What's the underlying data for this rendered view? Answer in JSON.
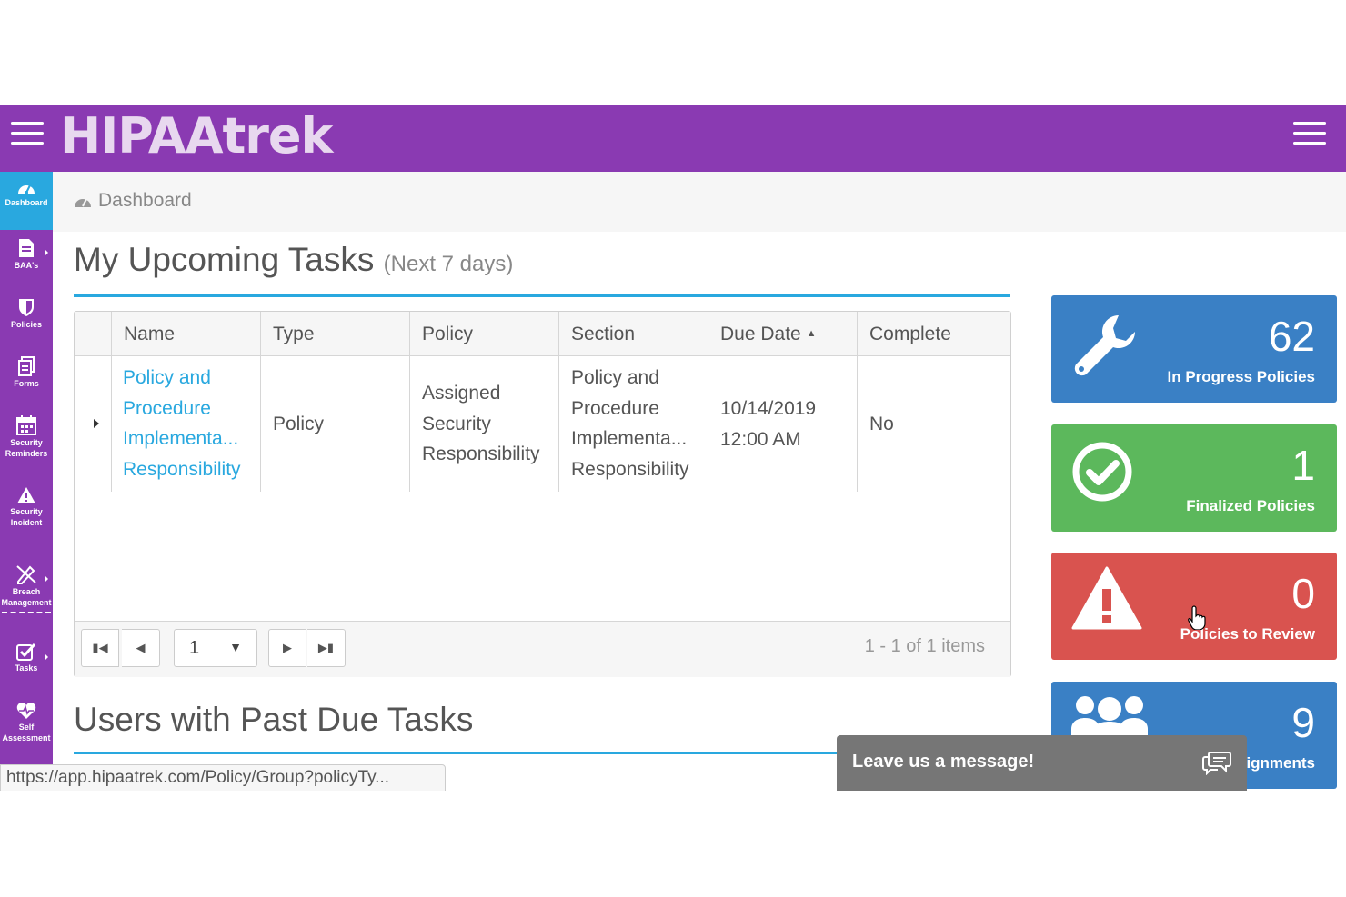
{
  "app": {
    "logo": "HIPAAtrek"
  },
  "sidebar": {
    "items": [
      {
        "label": "Dashboard",
        "icon": "dashboard-icon"
      },
      {
        "label": "BAA's",
        "icon": "document-icon"
      },
      {
        "label": "Policies",
        "icon": "shield-icon"
      },
      {
        "label": "Forms",
        "icon": "forms-icon"
      },
      {
        "label": "Security\nReminders",
        "icon": "calendar-icon"
      },
      {
        "label": "Security\nIncident",
        "icon": "warning-icon"
      },
      {
        "label": "Breach\nManagement",
        "icon": "breach-icon"
      },
      {
        "label": "Tasks",
        "icon": "tasks-icon"
      },
      {
        "label": "Self\nAssessment",
        "icon": "heartbeat-icon"
      }
    ]
  },
  "breadcrumb": {
    "label": "Dashboard"
  },
  "upcoming": {
    "title": "My Upcoming Tasks",
    "subtitle": "(Next 7 days)",
    "columns": [
      "Name",
      "Type",
      "Policy",
      "Section",
      "Due Date",
      "Complete"
    ],
    "rows": [
      {
        "name": [
          "Policy and",
          "Procedure",
          "Implementa...",
          "Responsibility"
        ],
        "type": "Policy",
        "policy": [
          "Assigned",
          "Security",
          "Responsibility"
        ],
        "section": [
          "Policy and",
          "Procedure",
          "Implementa...",
          "Responsibility"
        ],
        "due": [
          "10/14/2019",
          "12:00 AM"
        ],
        "complete": "No"
      }
    ],
    "pager": {
      "page": "1",
      "info": "1 - 1 of 1 items"
    }
  },
  "past_due": {
    "title": "Users with Past Due Tasks"
  },
  "tiles": [
    {
      "value": "62",
      "caption": "In Progress Policies",
      "color": "#3a80c5",
      "icon": "wrench-icon"
    },
    {
      "value": "1",
      "caption": "Finalized Policies",
      "color": "#5cb85c",
      "icon": "check-circle-icon"
    },
    {
      "value": "0",
      "caption": "Policies to Review",
      "color": "#d9534f",
      "icon": "warning-icon"
    },
    {
      "value": "9",
      "caption": "ignments",
      "color": "#3a80c5",
      "icon": "users-icon"
    }
  ],
  "status_url": "https://app.hipaatrek.com/Policy/Group?policyTy...",
  "chat": {
    "label": "Leave us a message!"
  }
}
